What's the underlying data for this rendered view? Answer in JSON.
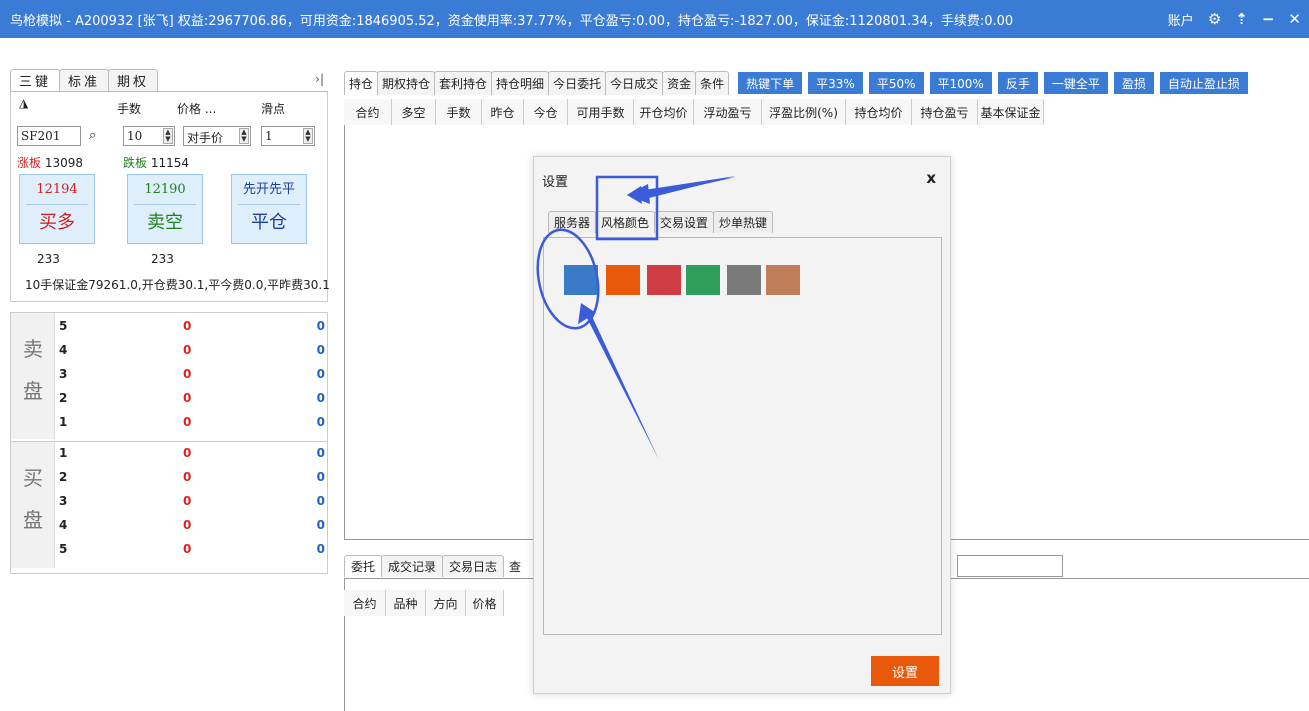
{
  "titlebar": {
    "title": "鸟枪模拟 - A200932 [张飞] 权益:2967706.86，可用资金:1846905.52，资金使用率:37.77%，平仓盈亏:0.00，持仓盈亏:-1827.00，保证金:1120801.34，手续费:0.00",
    "account_label": "账户",
    "gear_icon": "⚙",
    "pin_icon": "⇡",
    "minimize_icon": "−",
    "close_icon": "✕"
  },
  "left": {
    "tabs": [
      "三键",
      "标准",
      "期权"
    ],
    "collapse_icon": "›|",
    "lock_icon": "🔓",
    "labels": {
      "lots": "手数",
      "price": "价格 ...",
      "slippage": "滑点"
    },
    "symbol": "SF201",
    "search_icon": "⌕",
    "lots_value": "10",
    "price_value": "对手价",
    "slippage_value": "1",
    "limit_up_label": "涨板",
    "limit_up_value": "13098",
    "limit_down_label": "跌板",
    "limit_down_value": "11154",
    "buttons": [
      {
        "price": "12194",
        "action": "买多",
        "color": "#d02020"
      },
      {
        "price": "12190",
        "action": "卖空",
        "color": "#208020"
      },
      {
        "price": "先开先平",
        "action": "平仓",
        "color": "#2040a0"
      }
    ],
    "volumes": [
      "233",
      "233"
    ],
    "margin_info": "10手保证金79261.0,开仓费30.1,平今费0.0,平昨费30.1"
  },
  "orderbook": {
    "sell_label": [
      "卖",
      "盘"
    ],
    "buy_label": [
      "买",
      "盘"
    ],
    "sell_rows": [
      {
        "level": "5",
        "price": "0",
        "qty": "0"
      },
      {
        "level": "4",
        "price": "0",
        "qty": "0"
      },
      {
        "level": "3",
        "price": "0",
        "qty": "0"
      },
      {
        "level": "2",
        "price": "0",
        "qty": "0"
      },
      {
        "level": "1",
        "price": "0",
        "qty": "0"
      }
    ],
    "buy_rows": [
      {
        "level": "1",
        "price": "0",
        "qty": "0"
      },
      {
        "level": "2",
        "price": "0",
        "qty": "0"
      },
      {
        "level": "3",
        "price": "0",
        "qty": "0"
      },
      {
        "level": "4",
        "price": "0",
        "qty": "0"
      },
      {
        "level": "5",
        "price": "0",
        "qty": "0"
      }
    ]
  },
  "main": {
    "tabs": [
      "持仓",
      "期权持仓",
      "套利持仓",
      "持仓明细",
      "今日委托",
      "今日成交",
      "资金",
      "条件"
    ],
    "action_buttons": [
      "热键下单",
      "平33%",
      "平50%",
      "平100%",
      "反手",
      "一键全平",
      "盈损",
      "自动止盈止损"
    ],
    "columns": [
      "合约",
      "多空",
      "手数",
      "昨仓",
      "今仓",
      "可用手数",
      "开仓均价",
      "浮动盈亏",
      "浮盈比例(%)",
      "持仓均价",
      "持仓盈亏",
      "基本保证金"
    ]
  },
  "bottom": {
    "tabs": [
      "委托",
      "成交记录",
      "交易日志",
      "查"
    ],
    "columns": [
      "合约",
      "品种",
      "方向",
      "价格"
    ]
  },
  "dialog": {
    "title": "设置",
    "close": "x",
    "tabs": [
      "服务器",
      "风格颜色",
      "交易设置",
      "炒单热键"
    ],
    "swatches": [
      "#3a7bc8",
      "#e8590c",
      "#d03c44",
      "#2e9e5b",
      "#7a7a7a",
      "#c07d5a"
    ],
    "set_button": "设置"
  },
  "annotation_color": "#3b5bdb"
}
